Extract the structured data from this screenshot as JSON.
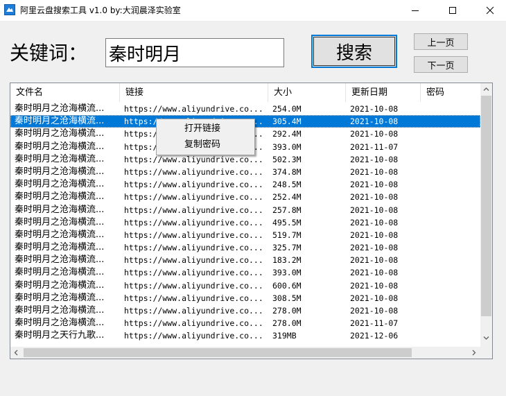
{
  "window": {
    "title": "阿里云盘搜索工具 v1.0   by:大润晨泽实验室",
    "icon": "app-logo-icon"
  },
  "search": {
    "label": "关键词：",
    "value": "秦时明月",
    "button_label": "搜索"
  },
  "pager": {
    "prev_label": "上一页",
    "next_label": "下一页"
  },
  "table": {
    "columns": [
      "文件名",
      "链接",
      "大小",
      "更新日期",
      "密码"
    ],
    "rows": [
      [
        "秦时明月之沧海横流...",
        "https://www.aliyundrive.co...",
        "254.0M",
        "2021-10-08",
        ""
      ],
      [
        "秦时明月之沧海横流...",
        "https://www.aliyundrive.co...",
        "305.4M",
        "2021-10-08",
        ""
      ],
      [
        "秦时明月之沧海横流...",
        "https://www.aliyundrive.co...",
        "292.4M",
        "2021-10-08",
        ""
      ],
      [
        "秦时明月之沧海横流...",
        "https://www.aliyundrive.co...",
        "393.0M",
        "2021-11-07",
        ""
      ],
      [
        "秦时明月之沧海横流...",
        "https://www.aliyundrive.co...",
        "502.3M",
        "2021-10-08",
        ""
      ],
      [
        "秦时明月之沧海横流...",
        "https://www.aliyundrive.co...",
        "374.8M",
        "2021-10-08",
        ""
      ],
      [
        "秦时明月之沧海横流...",
        "https://www.aliyundrive.co...",
        "248.5M",
        "2021-10-08",
        ""
      ],
      [
        "秦时明月之沧海横流...",
        "https://www.aliyundrive.co...",
        "252.4M",
        "2021-10-08",
        ""
      ],
      [
        "秦时明月之沧海横流...",
        "https://www.aliyundrive.co...",
        "257.8M",
        "2021-10-08",
        ""
      ],
      [
        "秦时明月之沧海横流...",
        "https://www.aliyundrive.co...",
        "495.5M",
        "2021-10-08",
        ""
      ],
      [
        "秦时明月之沧海横流...",
        "https://www.aliyundrive.co...",
        "519.7M",
        "2021-10-08",
        ""
      ],
      [
        "秦时明月之沧海横流...",
        "https://www.aliyundrive.co...",
        "325.7M",
        "2021-10-08",
        ""
      ],
      [
        "秦时明月之沧海横流...",
        "https://www.aliyundrive.co...",
        "183.2M",
        "2021-10-08",
        ""
      ],
      [
        "秦时明月之沧海横流...",
        "https://www.aliyundrive.co...",
        "393.0M",
        "2021-10-08",
        ""
      ],
      [
        "秦时明月之沧海横流...",
        "https://www.aliyundrive.co...",
        "600.6M",
        "2021-10-08",
        ""
      ],
      [
        "秦时明月之沧海横流...",
        "https://www.aliyundrive.co...",
        "308.5M",
        "2021-10-08",
        ""
      ],
      [
        "秦时明月之沧海横流...",
        "https://www.aliyundrive.co...",
        "278.0M",
        "2021-10-08",
        ""
      ],
      [
        "秦时明月之沧海横流...",
        "https://www.aliyundrive.co...",
        "278.0M",
        "2021-11-07",
        ""
      ],
      [
        "秦时明月之天行九歌...",
        "https://www.aliyundrive.co...",
        "319MB",
        "2021-12-06",
        ""
      ]
    ],
    "selected_row": 1
  },
  "context_menu": {
    "items": [
      "打开链接",
      "复制密码"
    ]
  },
  "colors": {
    "selection": "#0078d7",
    "window_bg": "#f0f0f0",
    "focus_border": "#0078d7"
  }
}
